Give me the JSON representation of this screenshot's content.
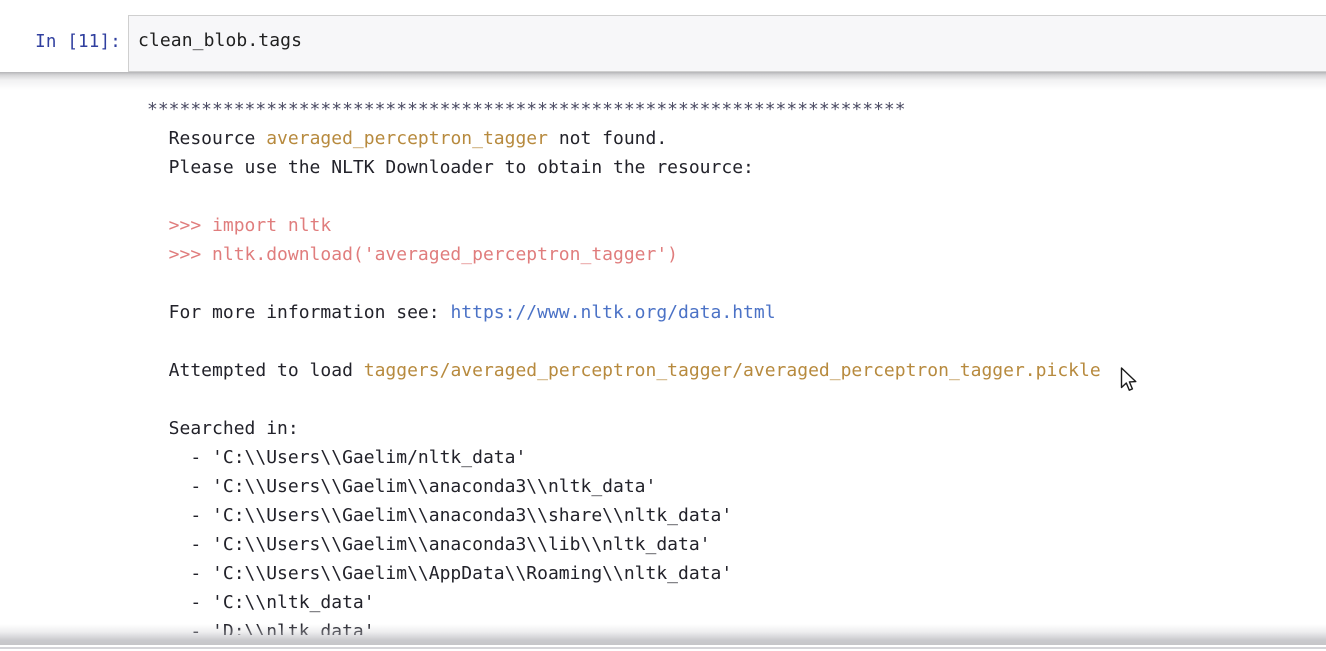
{
  "notebook": {
    "input_prompt": "In [11]:",
    "input_code": "clean_blob.tags"
  },
  "colors": {
    "prompt": "#303f9f",
    "resource_name": "#b78a3e",
    "repl_prompt": "#e07d7d",
    "url": "#4b72c6",
    "body_text": "#22222a",
    "stars": "#4b4b63",
    "input_bg": "#f7f7f9"
  },
  "output": {
    "stars_line": "**********************************************************************",
    "line_resource_pre": "  Resource ",
    "line_resource_name": "averaged_perceptron_tagger",
    "line_resource_post": " not found.",
    "line_downloader": "  Please use the NLTK Downloader to obtain the resource:",
    "blank1": "",
    "repl_import": "  >>> import nltk",
    "repl_download": "  >>> nltk.download('averaged_perceptron_tagger')",
    "blank2": "",
    "line_info_pre": "  For more information see: ",
    "line_info_url": "https://www.nltk.org/data.html",
    "blank3": "",
    "line_attempt_pre": "  Attempted to load ",
    "line_attempt_path": "taggers/averaged_perceptron_tagger/averaged_perceptron_tagger.pickle",
    "blank4": "",
    "line_searched": "  Searched in:",
    "paths": [
      "    - 'C:\\\\Users\\\\Gaelim/nltk_data'",
      "    - 'C:\\\\Users\\\\Gaelim\\\\anaconda3\\\\nltk_data'",
      "    - 'C:\\\\Users\\\\Gaelim\\\\anaconda3\\\\share\\\\nltk_data'",
      "    - 'C:\\\\Users\\\\Gaelim\\\\anaconda3\\\\lib\\\\nltk_data'",
      "    - 'C:\\\\Users\\\\Gaelim\\\\AppData\\\\Roaming\\\\nltk_data'",
      "    - 'C:\\\\nltk_data'",
      "    - 'D:\\\\nltk_data'"
    ]
  }
}
